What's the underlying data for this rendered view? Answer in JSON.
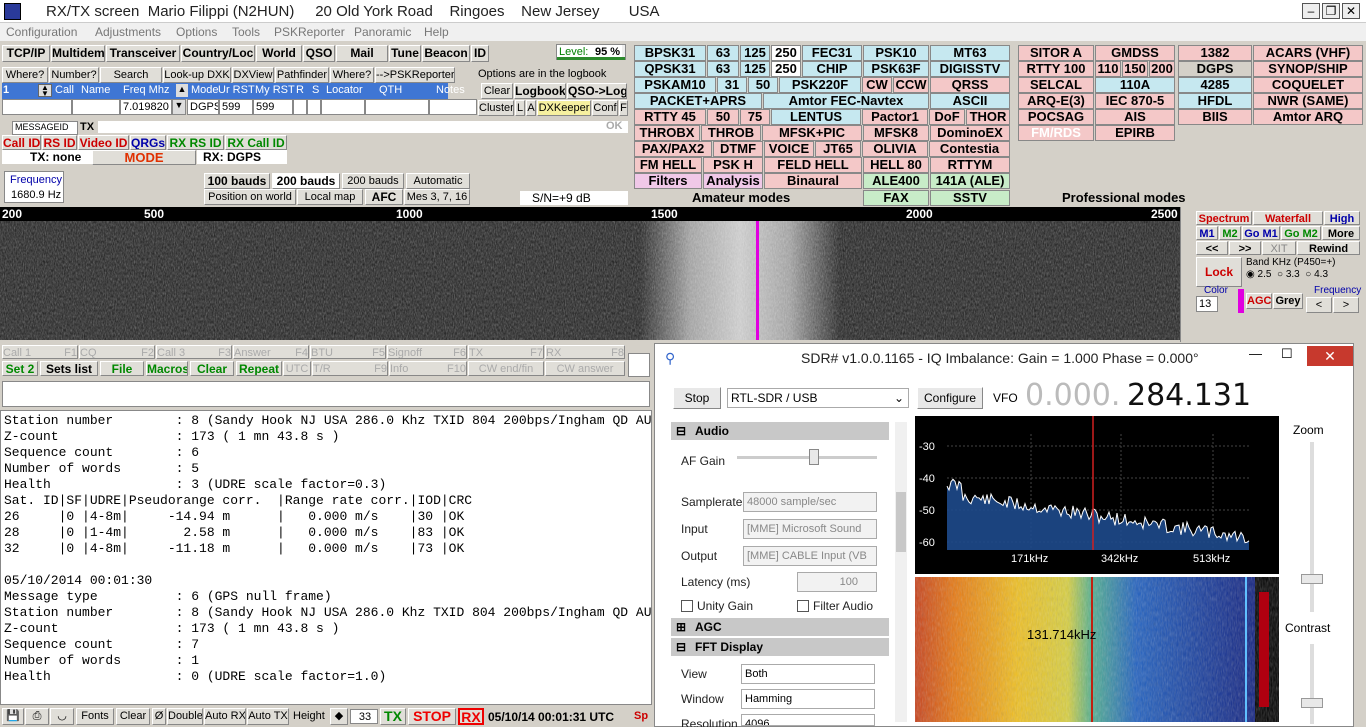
{
  "title": "RX/TX screen  Mario Filippi (N2HUN)     20 Old York Road    Ringoes    New Jersey       USA",
  "menu": [
    "Configuration",
    "Adjustments",
    "Options",
    "Tools",
    "PSKReporter",
    "Panoramic",
    "Help"
  ],
  "toolbar": {
    "items": [
      "TCP/IP",
      "Multidem",
      "Transceiver",
      "Country/Loc",
      "World",
      "QSO",
      "Mail",
      "Tune",
      "Beacon",
      "ID"
    ],
    "level_label": "Level:",
    "level_value": "95 %",
    "level_fraction": 0.95
  },
  "lookup": {
    "buttons": [
      "Where?",
      "Number?",
      "Search",
      "Look-up DXK",
      "DXView",
      "Pathfinder",
      "Where?",
      "-->PSKReporter"
    ],
    "note": "Options are in the logbook"
  },
  "log": {
    "headers": [
      "Call",
      "Name",
      "Freq Mhz",
      "Mode",
      "Ur RST",
      "My RST",
      "R",
      "S",
      "Locator",
      "QTH",
      "Notes"
    ],
    "row_num": "1",
    "freq": "7.019820",
    "mode": "DGPS",
    "ur_rst": "599",
    "my_rst": "599"
  },
  "log_buttons": [
    "Clear",
    "Logbook",
    "QSO->Log",
    "Cluster",
    "L",
    "A",
    "DXKeeper",
    "Conf",
    "F"
  ],
  "messageid": "MESSAGEID",
  "tx_tab": "TX",
  "ok": "OK",
  "id_buttons": [
    "Call ID",
    "RS ID",
    "Video ID",
    "QRGs",
    "RX RS ID",
    "RX Call ID"
  ],
  "txrx": {
    "tx": "TX: none",
    "mode": "MODE",
    "rx": "RX: DGPS"
  },
  "freq": {
    "label": "Frequency",
    "value": "1680.9 Hz"
  },
  "baud": [
    "100 bauds",
    "200 bauds",
    "200 bauds",
    "Automatic"
  ],
  "misc": [
    "Position on world",
    "Local map",
    "AFC",
    "Mes 3, 7, 16"
  ],
  "snr": "S/N=+9  dB",
  "amateur": {
    "title": "Amateur modes",
    "rows": [
      [
        "BPSK31",
        "63",
        "125",
        "250",
        "FEC31",
        "PSK10",
        "MT63"
      ],
      [
        "QPSK31",
        "63",
        "125",
        "250",
        "CHIP",
        "PSK63F",
        "DIGISSTV"
      ],
      [
        "PSKAM10",
        "31",
        "50",
        "PSK220F",
        "CW",
        "CCW",
        "QRSS"
      ],
      [
        "PACKET+APRS",
        "Amtor FEC-Navtex",
        "ASCII"
      ],
      [
        "RTTY 45",
        "50",
        "75",
        "LENTUS",
        "Pactor1",
        "DoF",
        "THOR"
      ],
      [
        "THROBX",
        "THROB",
        "MFSK+PIC",
        "MFSK8",
        "DominoEX"
      ],
      [
        "PAX/PAX2",
        "DTMF",
        "VOICE",
        "JT65",
        "OLIVIA",
        "Contestia"
      ],
      [
        "FM HELL",
        "PSK H",
        "FELD HELL",
        "HELL 80",
        "RTTYM"
      ],
      [
        "Filters",
        "Analysis",
        "Binaural",
        "ALE400",
        "141A (ALE)"
      ],
      [
        "FAX",
        "SSTV"
      ]
    ]
  },
  "professional": {
    "title": "Professional modes",
    "rows": [
      [
        "SITOR A",
        "GMDSS",
        "1382",
        "ACARS (VHF)"
      ],
      [
        "RTTY 100",
        "110",
        "150",
        "200",
        "DGPS",
        "SYNOP/SHIP"
      ],
      [
        "SELCAL",
        "110A",
        "4285",
        "COQUELET"
      ],
      [
        "ARQ-E(3)",
        "IEC 870-5",
        "HFDL",
        "NWR (SAME)"
      ],
      [
        "POCSAG",
        "AIS",
        "BIIS",
        "Amtor ARQ"
      ],
      [
        "FM/RDS",
        "EPIRB"
      ]
    ]
  },
  "ruler": [
    "200",
    "500",
    "1000",
    "1500",
    "2000",
    "2500"
  ],
  "right_panel": {
    "spectrum": "Spectrum",
    "waterfall": "Waterfall",
    "high": "High",
    "m1": "M1",
    "m2": "M2",
    "gom1": "Go M1",
    "gom2": "Go M2",
    "more": "More",
    "prev": "<<",
    "next": ">>",
    "xit": "XIT",
    "rewind": "Rewind",
    "lock": "Lock",
    "band": "Band KHz (P450=+)",
    "b1": "2.5",
    "b2": "3.3",
    "b3": "4.3",
    "color": "Color",
    "color_val": "13",
    "agc": "AGC",
    "grey": "Grey",
    "frequency": "Frequency",
    "l": "<",
    "r": ">"
  },
  "macros": {
    "row1": [
      "Call 1",
      "F1",
      "CQ",
      "F2",
      "Call 3",
      "F3",
      "Answer",
      "F4",
      "BTU",
      "F5",
      "Signoff",
      "F6",
      "TX",
      "F7",
      "RX",
      "F8"
    ],
    "row2": [
      "Set 2",
      "Sets list",
      "File",
      "Macros",
      "Clear",
      "Repeat",
      "UTC",
      "T/R",
      "F9",
      "Info",
      "F10",
      "CW end/fin",
      "CW answer"
    ]
  },
  "rx_lines": [
    "Station number        : 8 (Sandy Hook NJ USA 286.0 Khz TXID 804 200bps/Ingham QD AU",
    "Z-count               : 173 ( 1 mn 43.8 s )",
    "Sequence count        : 6",
    "Number of words       : 5",
    "Health                : 3 (UDRE scale factor=0.3)",
    "Sat. ID|SF|UDRE|Pseudorange corr.  |Range rate corr.|IOD|CRC",
    "26     |0 |4-8m|     -14.94 m      |   0.000 m/s    |30 |OK",
    "28     |0 |1-4m|       2.58 m      |   0.000 m/s    |83 |OK",
    "32     |0 |4-8m|     -11.18 m      |   0.000 m/s    |73 |OK",
    "",
    "05/10/2014 00:01:30",
    "Message type          : 6 (GPS null frame)",
    "Station number        : 8 (Sandy Hook NJ USA 286.0 Khz TXID 804 200bps/Ingham QD AU",
    "Z-count               : 173 ( 1 mn 43.8 s )",
    "Sequence count        : 7",
    "Number of words       : 1",
    "Health                : 0 (UDRE scale factor=1.0)"
  ],
  "bottom": {
    "fonts": "Fonts",
    "clear": "Clear",
    "zero": "Ø",
    "double": "Double",
    "autorx": "Auto RX",
    "autotx": "Auto TX",
    "height": "Height",
    "height_val": "33",
    "tx": "TX",
    "stop": "STOP",
    "rx": "RX",
    "datetime": "05/10/14 00:01:31 UTC",
    "sp": "Sp"
  },
  "sdr": {
    "title": "SDR# v1.0.0.1165 - IQ Imbalance: Gain = 1.000 Phase = 0.000°",
    "stop": "Stop",
    "device": "RTL-SDR / USB",
    "configure": "Configure",
    "vfo_label": "VFO",
    "vfo_dim": "0.000.",
    "vfo_main": "284.131",
    "audio": "Audio",
    "af_gain": "AF Gain",
    "af_gain_level": 0.55,
    "samplerate_label": "Samplerate",
    "samplerate": "48000 sample/sec",
    "input_label": "Input",
    "input": "[MME] Microsoft Sound",
    "output_label": "Output",
    "output": "[MME] CABLE Input (VB",
    "latency_label": "Latency (ms)",
    "latency": "100",
    "unity": "Unity Gain",
    "filter_audio": "Filter Audio",
    "agc": "AGC",
    "fft": "FFT Display",
    "view_label": "View",
    "view": "Both",
    "window_label": "Window",
    "window": "Hamming",
    "resolution_label": "Resolution",
    "resolution": "4096",
    "zoom": "Zoom",
    "contrast": "Contrast",
    "y_ticks": [
      "-30",
      "-40",
      "-50",
      "-60"
    ],
    "x_ticks": [
      "171kHz",
      "342kHz",
      "513kHz"
    ],
    "wf_label": "131.714kHz"
  }
}
